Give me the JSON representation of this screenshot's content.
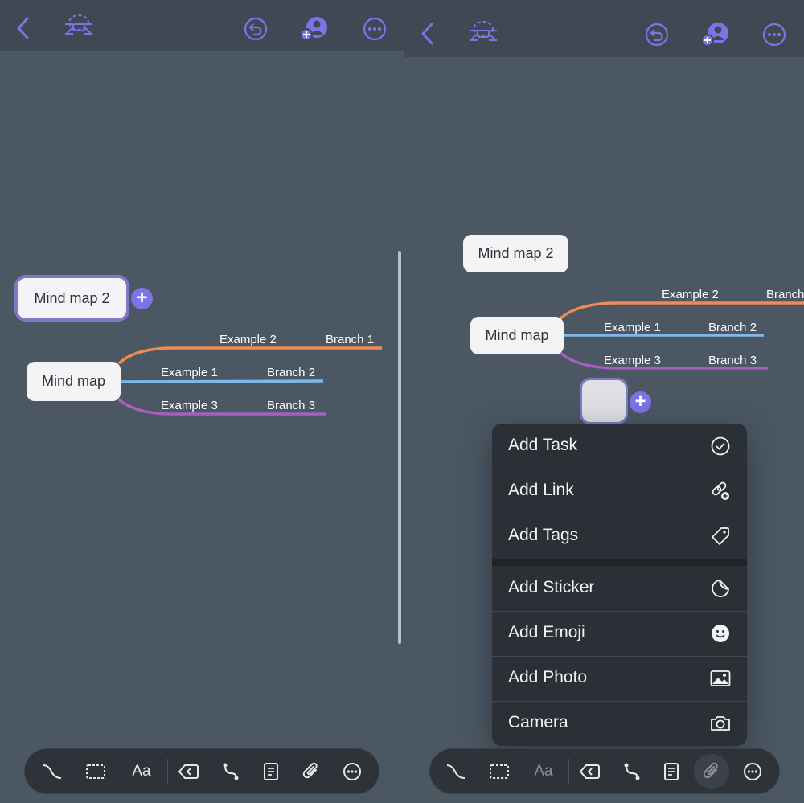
{
  "left": {
    "nodes": {
      "root": "Mind map",
      "mindmap2": "Mind map 2"
    },
    "branches": [
      {
        "example": "Example 2",
        "branch": "Branch 1",
        "color": "#f08a54"
      },
      {
        "example": "Example 1",
        "branch": "Branch 2",
        "color": "#7fb8e8"
      },
      {
        "example": "Example 3",
        "branch": "Branch 3",
        "color": "#a55fc0"
      }
    ]
  },
  "right": {
    "nodes": {
      "root": "Mind map",
      "mindmap2": "Mind map 2"
    },
    "branches": [
      {
        "example": "Example 2",
        "branch": "Branch",
        "color": "#f08a54"
      },
      {
        "example": "Example 1",
        "branch": "Branch 2",
        "color": "#7fb8e8"
      },
      {
        "example": "Example 3",
        "branch": "Branch 3",
        "color": "#a55fc0"
      }
    ]
  },
  "menu": {
    "items": [
      {
        "label": "Add Task",
        "icon": "checkmark-circle-icon"
      },
      {
        "label": "Add Link",
        "icon": "link-add-icon"
      },
      {
        "label": "Add Tags",
        "icon": "tag-icon"
      },
      {
        "label": "Add Sticker",
        "icon": "sticker-icon"
      },
      {
        "label": "Add Emoji",
        "icon": "emoji-icon"
      },
      {
        "label": "Add Photo",
        "icon": "photo-icon"
      },
      {
        "label": "Camera",
        "icon": "camera-icon"
      }
    ]
  },
  "toolbar": {
    "text_style_label": "Aa"
  },
  "colors": {
    "accent": "#7b73e6",
    "canvas": "#4b5864",
    "topbar": "#3f4953",
    "toolbar": "#2e3339"
  }
}
